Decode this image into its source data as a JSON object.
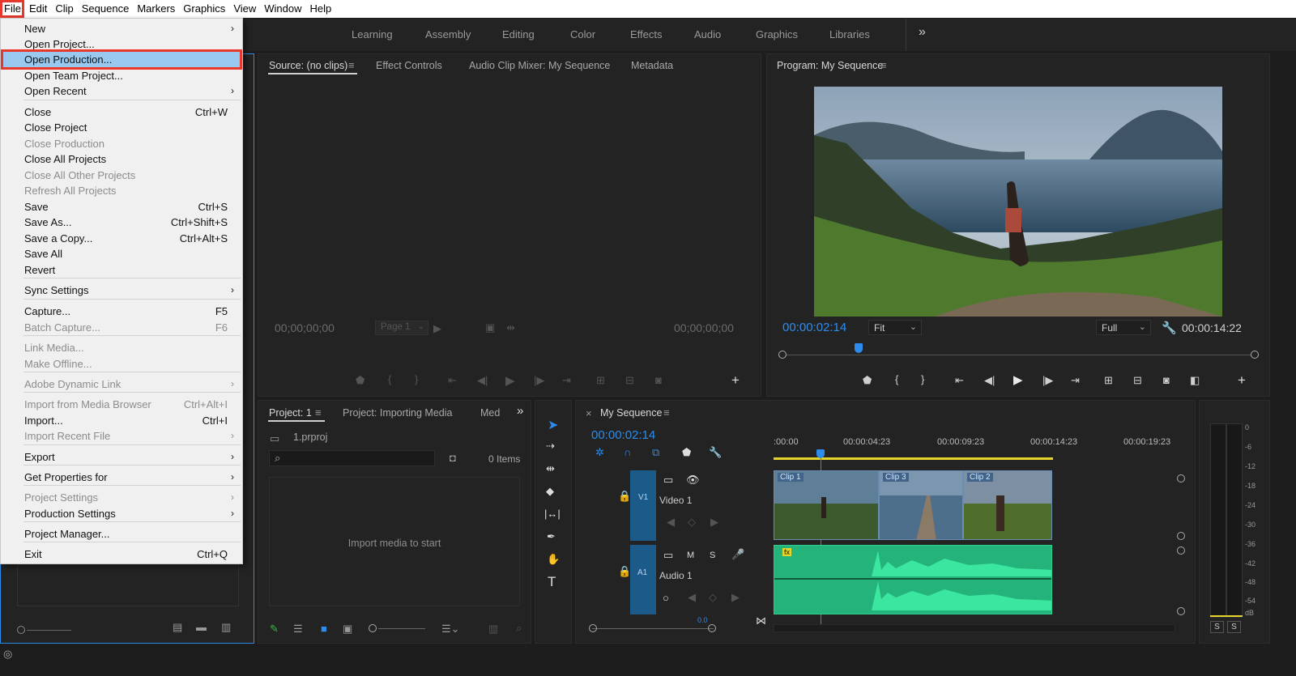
{
  "menubar": {
    "items": [
      "File",
      "Edit",
      "Clip",
      "Sequence",
      "Markers",
      "Graphics",
      "View",
      "Window",
      "Help"
    ]
  },
  "workspaces": [
    "Learning",
    "Assembly",
    "Editing",
    "Color",
    "Effects",
    "Audio",
    "Graphics",
    "Libraries",
    "»"
  ],
  "file_menu": {
    "items": [
      {
        "label": "New",
        "shortcut": "",
        "submenu": true,
        "disabled": false
      },
      {
        "label": "Open Project...",
        "shortcut": "",
        "submenu": false,
        "disabled": false
      },
      {
        "label": "Open Production...",
        "shortcut": "",
        "submenu": false,
        "disabled": false,
        "highlighted": true
      },
      {
        "label": "Open Team Project...",
        "shortcut": "",
        "submenu": false,
        "disabled": false
      },
      {
        "label": "Open Recent",
        "shortcut": "",
        "submenu": true,
        "disabled": false
      },
      {
        "label": "Close",
        "shortcut": "Ctrl+W",
        "submenu": false,
        "disabled": false
      },
      {
        "label": "Close Project",
        "shortcut": "",
        "submenu": false,
        "disabled": false
      },
      {
        "label": "Close Production",
        "shortcut": "",
        "submenu": false,
        "disabled": true
      },
      {
        "label": "Close All Projects",
        "shortcut": "",
        "submenu": false,
        "disabled": false
      },
      {
        "label": "Close All Other Projects",
        "shortcut": "",
        "submenu": false,
        "disabled": true
      },
      {
        "label": "Refresh All Projects",
        "shortcut": "",
        "submenu": false,
        "disabled": true
      },
      {
        "label": "Save",
        "shortcut": "Ctrl+S",
        "submenu": false,
        "disabled": false
      },
      {
        "label": "Save As...",
        "shortcut": "Ctrl+Shift+S",
        "submenu": false,
        "disabled": false
      },
      {
        "label": "Save a Copy...",
        "shortcut": "Ctrl+Alt+S",
        "submenu": false,
        "disabled": false
      },
      {
        "label": "Save All",
        "shortcut": "",
        "submenu": false,
        "disabled": false
      },
      {
        "label": "Revert",
        "shortcut": "",
        "submenu": false,
        "disabled": false
      },
      {
        "label": "Sync Settings",
        "shortcut": "",
        "submenu": true,
        "disabled": false
      },
      {
        "label": "Capture...",
        "shortcut": "F5",
        "submenu": false,
        "disabled": false
      },
      {
        "label": "Batch Capture...",
        "shortcut": "F6",
        "submenu": false,
        "disabled": true
      },
      {
        "label": "Link Media...",
        "shortcut": "",
        "submenu": false,
        "disabled": true
      },
      {
        "label": "Make Offline...",
        "shortcut": "",
        "submenu": false,
        "disabled": true
      },
      {
        "label": "Adobe Dynamic Link",
        "shortcut": "",
        "submenu": true,
        "disabled": true
      },
      {
        "label": "Import from Media Browser",
        "shortcut": "Ctrl+Alt+I",
        "submenu": false,
        "disabled": true
      },
      {
        "label": "Import...",
        "shortcut": "Ctrl+I",
        "submenu": false,
        "disabled": false
      },
      {
        "label": "Import Recent File",
        "shortcut": "",
        "submenu": true,
        "disabled": true
      },
      {
        "label": "Export",
        "shortcut": "",
        "submenu": true,
        "disabled": false
      },
      {
        "label": "Get Properties for",
        "shortcut": "",
        "submenu": true,
        "disabled": false
      },
      {
        "label": "Project Settings",
        "shortcut": "",
        "submenu": true,
        "disabled": true
      },
      {
        "label": "Production Settings",
        "shortcut": "",
        "submenu": true,
        "disabled": false
      },
      {
        "label": "Project Manager...",
        "shortcut": "",
        "submenu": false,
        "disabled": false
      },
      {
        "label": "Exit",
        "shortcut": "Ctrl+Q",
        "submenu": false,
        "disabled": false
      }
    ]
  },
  "source_panel": {
    "tabs": [
      "Source: (no clips)",
      "Effect Controls",
      "Audio Clip Mixer: My Sequence",
      "Metadata"
    ],
    "timecode_in": "00;00;00;00",
    "timecode_out": "00;00;00;00",
    "page": "Page 1"
  },
  "program_panel": {
    "title": "Program: My Sequence",
    "timecode": "00:00:02:14",
    "zoom": "Fit",
    "quality": "Full",
    "duration": "00:00:14:22"
  },
  "project_panel": {
    "tabs": [
      "Project: 1",
      "Project: Importing Media",
      "Med",
      "»"
    ],
    "filename": "1.prproj",
    "items_count": "0 Items",
    "empty_text": "Import media to start"
  },
  "timeline": {
    "title": "My Sequence",
    "timecode": "00:00:02:14",
    "ruler": [
      ":00:00",
      "00:00:04:23",
      "00:00:09:23",
      "00:00:14:23",
      "00:00:19:23"
    ],
    "video_track": {
      "id": "V1",
      "name": "Video 1"
    },
    "audio_track": {
      "id": "A1",
      "name": "Audio 1",
      "m": "M",
      "s": "S"
    },
    "clips": [
      "Clip 1",
      "Clip 3",
      "Clip 2"
    ],
    "zoom_label": "0.0"
  },
  "meter": {
    "scale": [
      "0",
      "-6",
      "-12",
      "-18",
      "-24",
      "-30",
      "-36",
      "-42",
      "-48",
      "-54",
      "dB"
    ],
    "solo": [
      "S",
      "S"
    ]
  },
  "colors": {
    "accent": "#2d8ceb",
    "highlight": "#99c9ef",
    "marker_red": "#e8382c",
    "audio": "#2bd08e"
  }
}
